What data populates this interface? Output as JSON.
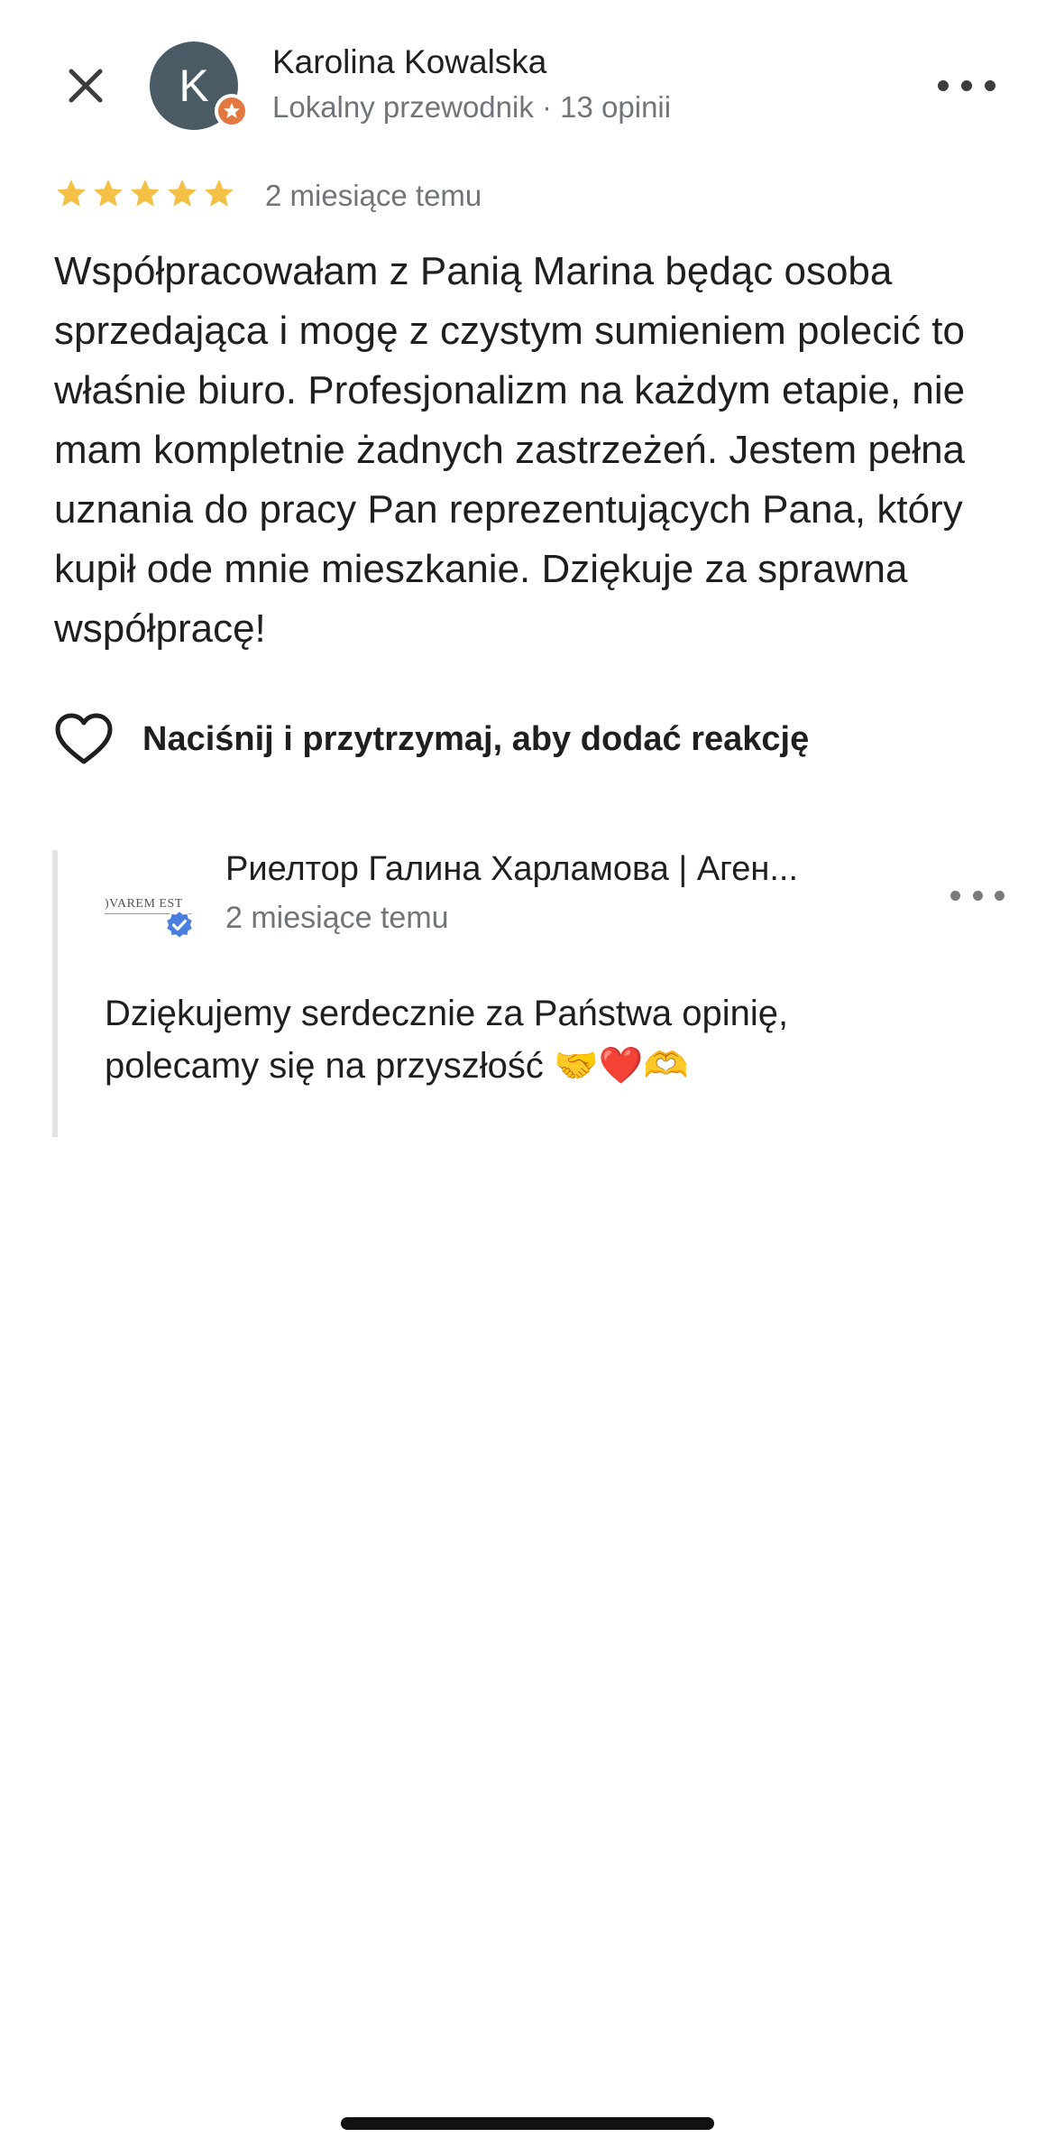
{
  "header": {
    "close_icon": "close-icon",
    "more_icon": "more-horizontal-icon"
  },
  "reviewer": {
    "avatar_initial": "K",
    "name": "Karolina Kowalska",
    "meta": "Lokalny przewodnik · 13 opinii",
    "badge_icon": "local-guide-star-icon",
    "badge_color": "#e2783f",
    "avatar_color": "#4b5b66"
  },
  "review": {
    "rating": 5,
    "rating_max": 5,
    "star_color": "#f4c045",
    "date": "2 miesiące temu",
    "text": "Współpracowałam z Panią Marina będąc osoba sprzedająca i mogę z czystym sumieniem polecić to właśnie biuro. Profesjonalizm na każdym etapie, nie mam kompletnie żadnych zastrzeżeń. Jestem pełna uznania do pracy Pan reprezentujących Pana, który kupił ode mnie mieszkanie. Dziękuje za sprawna współpracę!"
  },
  "reaction": {
    "icon": "heart-outline-icon",
    "label": "Naciśnij i przytrzymaj, aby dodać reakcję"
  },
  "owner_response": {
    "logo_text": ")VAREM EST",
    "verified_icon": "verified-badge-icon",
    "verified_color": "#4a7fe0",
    "name": "Риелтор Галина Харламова | Аген...",
    "date": "2 miesiące temu",
    "more_icon": "more-horizontal-icon",
    "text": "Dziękujemy serdecznie za Państwa opinię, polecamy się na przyszłość 🤝❤️🫶"
  }
}
